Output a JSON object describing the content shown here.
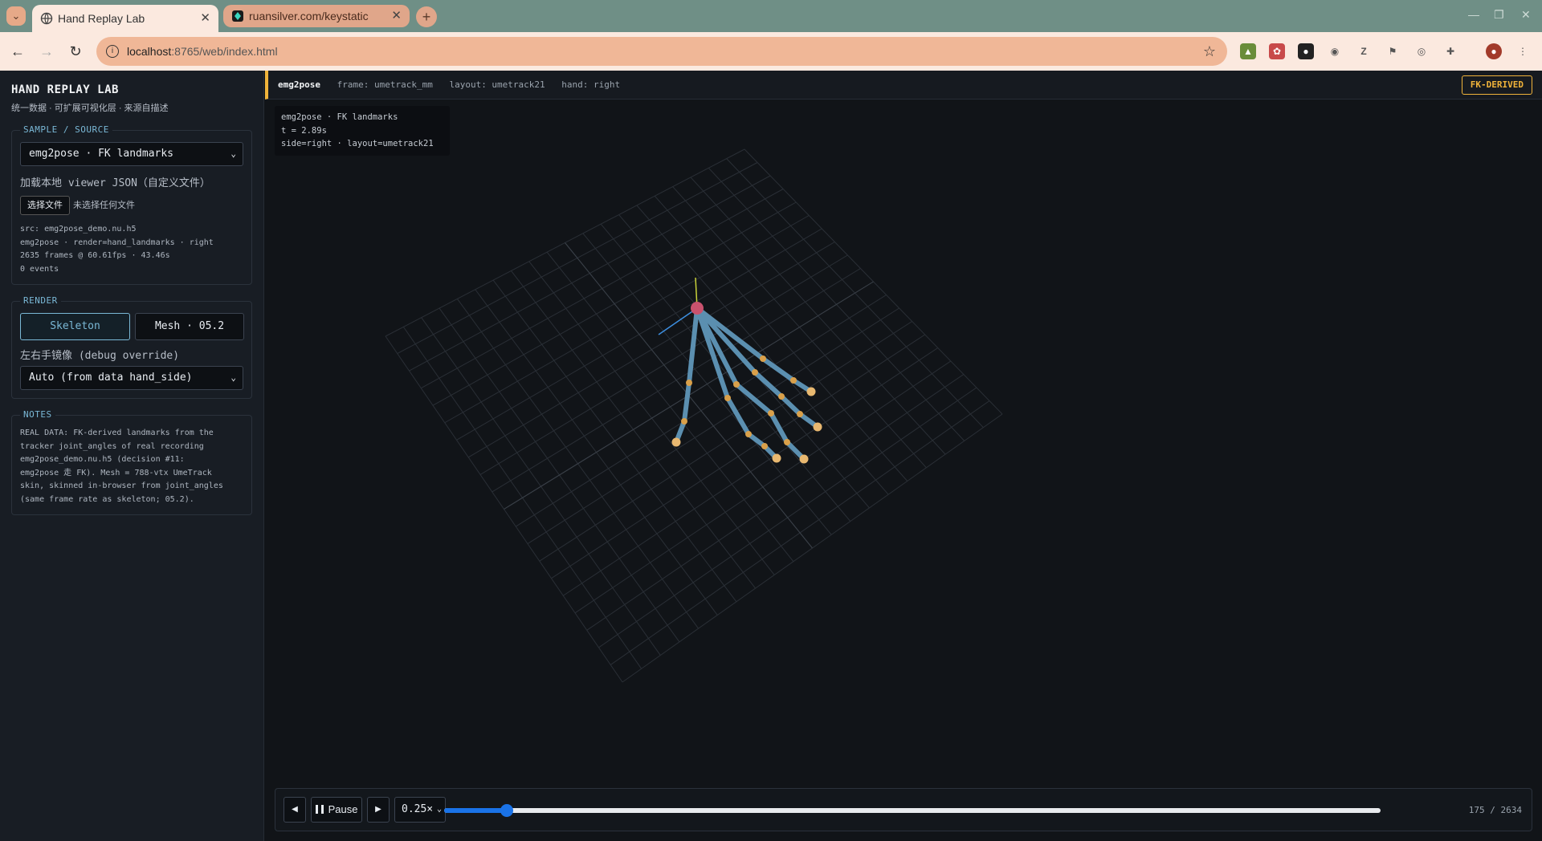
{
  "browser": {
    "tabs": [
      {
        "title": "Hand Replay Lab",
        "active": true
      },
      {
        "title": "ruansilver.com/keystatic",
        "active": false
      }
    ],
    "url_host": "localhost",
    "url_path": ":8765/web/index.html",
    "extensions": [
      "ext-green",
      "ext-multicolor",
      "ext-red",
      "screenshot-icon",
      "z-icon",
      "pin-icon",
      "circle-icon",
      "puzzle-icon"
    ]
  },
  "sidebar": {
    "title": "HAND REPLAY LAB",
    "subtitle": "统一数据 · 可扩展可视化层 · 来源自描述",
    "source_panel": {
      "legend": "SAMPLE / SOURCE",
      "selected_sample": "emg2pose · FK landmarks",
      "load_label": "加载本地 viewer JSON（自定义文件）",
      "file_button": "选择文件",
      "file_status": "未选择任何文件",
      "meta_lines": [
        "src: emg2pose_demo.nu.h5",
        "emg2pose · render=hand_landmarks · right",
        "2635 frames @ 60.61fps · 43.46s",
        "0 events"
      ]
    },
    "render_panel": {
      "legend": "RENDER",
      "skeleton_label": "Skeleton",
      "mesh_label": "Mesh · 05.2",
      "mirror_label": "左右手镜像 (debug override)",
      "mirror_selected": "Auto (from data hand_side)"
    },
    "notes_panel": {
      "legend": "NOTES",
      "lines": [
        "REAL DATA: FK-derived landmarks from the",
        "tracker joint_angles of real recording",
        "emg2pose_demo.nu.h5 (decision #11:",
        "emg2pose 走 FK). Mesh = 788-vtx UmeTrack",
        "skin, skinned in-browser from joint_angles",
        "(same frame rate as skeleton; 05.2)."
      ]
    }
  },
  "infobar": {
    "source": "emg2pose",
    "frame": "frame: umetrack_mm",
    "layout": "layout: umetrack21",
    "hand": "hand: right",
    "badge": "FK-DERIVED"
  },
  "overlay": {
    "line1": "emg2pose · FK landmarks",
    "line2": "t = 2.89s",
    "line3": "side=right · layout=umetrack21"
  },
  "colors": {
    "accent": "#f0b33a",
    "bone": "#5b8fb0",
    "joint": "#d9a04a",
    "wrist": "#c9526e",
    "legend": "#7ab8d6"
  },
  "playback": {
    "prev_label": "◀",
    "pause_label": "Pause",
    "next_label": "▶",
    "speed": "0.25×",
    "progress": 0.0665,
    "counter": "175 / 2634"
  }
}
